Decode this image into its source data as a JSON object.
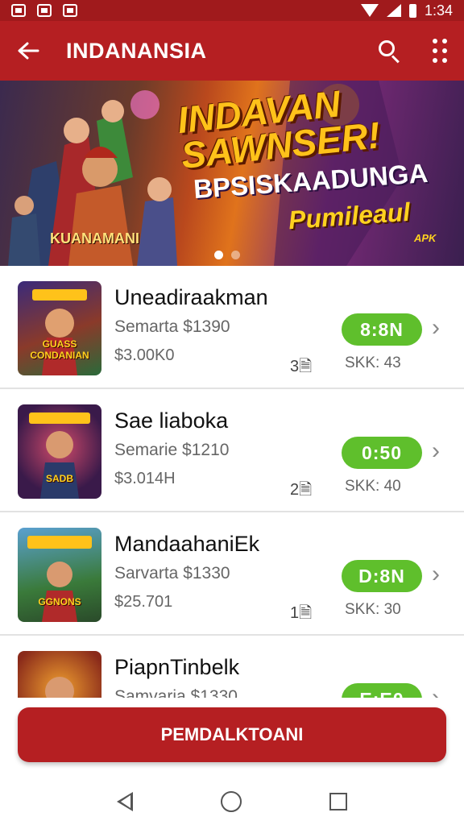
{
  "status_bar": {
    "time": "1:34",
    "icons": [
      "notification-icon",
      "notification-icon",
      "notification-icon",
      "wifi-icon",
      "signal-icon",
      "battery-icon"
    ]
  },
  "app_bar": {
    "title": "INDANANSIA",
    "back_icon": "arrow-left-icon",
    "search_icon": "search-icon",
    "more_icon": "more-grid-icon"
  },
  "banner": {
    "title": "INDAVAN SAWNSER!",
    "subtitle": "BPSISKAADUNGA",
    "tagline": "Pumileaul",
    "caption": "KUANAMANI",
    "badge": "APK",
    "slides": 2,
    "active_slide": 0
  },
  "items": [
    {
      "title": "Uneadiraakman",
      "meta": "Semarta  $1390",
      "price": "$3.00K0",
      "count": "3🗎",
      "sku": "SKK: 43",
      "badge": "8:8N",
      "thumb_label": "GUASS CONDANIAN"
    },
    {
      "title": "Sae liaboka",
      "meta": "Semarie  $1210",
      "price": "$3.014H",
      "count": "2🗎",
      "sku": "SKK: 40",
      "badge": "0:50",
      "thumb_label": "SADB"
    },
    {
      "title": "MandaahaniEk",
      "meta": "Sarvarta  $1330",
      "price": "$25.701",
      "count": "1🗎",
      "sku": "SKK: 30",
      "badge": "D:8N",
      "thumb_label": "GGNONS"
    },
    {
      "title": "PiapnTinbelk",
      "meta": "Samvaria  $1330",
      "price": "",
      "count": "",
      "sku": "",
      "badge": "E:E0",
      "thumb_label": ""
    }
  ],
  "footer": {
    "primary_button": "PEMDALKTOANI"
  },
  "nav_bar": {
    "back_icon": "nav-back-icon",
    "home_icon": "nav-home-icon",
    "recent_icon": "nav-recent-icon"
  },
  "colors": {
    "primary": "#b51f22",
    "status": "#a01a1c",
    "badge_green": "#5fbf2c"
  }
}
